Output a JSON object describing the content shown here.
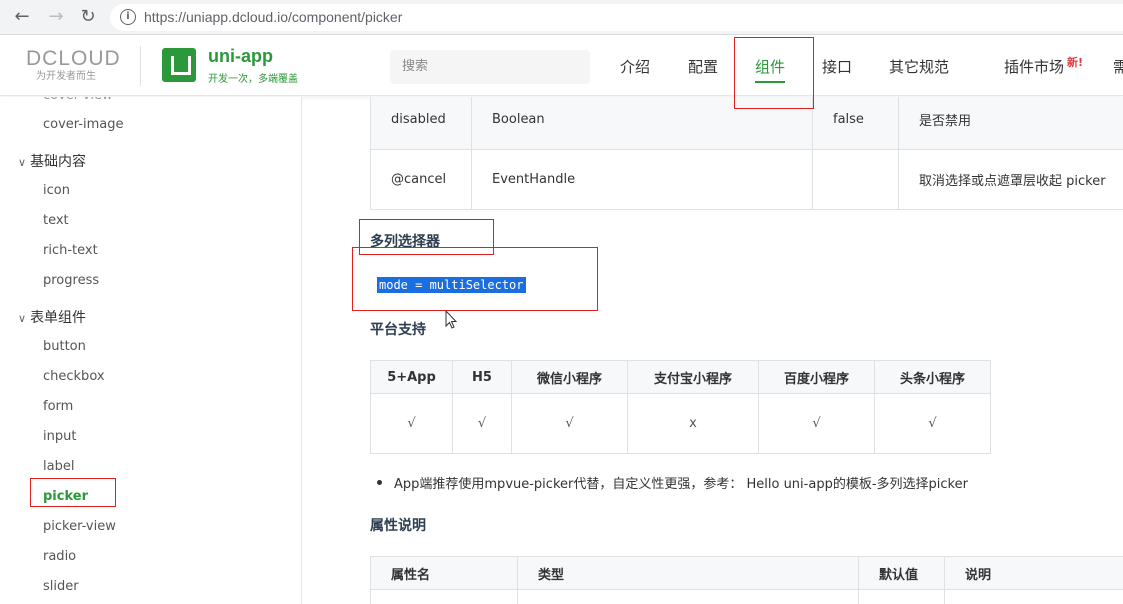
{
  "browser": {
    "url": "https://uniapp.dcloud.io/component/picker",
    "back": "←",
    "forward": "→",
    "reload": "↻",
    "info": "i"
  },
  "header": {
    "dcloud_name": "DCLOUD",
    "dcloud_slogan": "为开发者而生",
    "app_title": "uni-app",
    "app_slogan": "开发一次，多端覆盖",
    "search_placeholder": "搜索",
    "menu": [
      {
        "label": "介绍"
      },
      {
        "label": "配置"
      },
      {
        "label": "组件"
      },
      {
        "label": "接口"
      },
      {
        "label": "其它规范"
      },
      {
        "label": "插件市场",
        "badge": "新!"
      },
      {
        "label": "需"
      }
    ],
    "accent": "#2b9939"
  },
  "sidebar": {
    "items": [
      {
        "label": "cover-view"
      },
      {
        "label": "cover-image"
      },
      {
        "label": "基础内容"
      },
      {
        "label": "icon"
      },
      {
        "label": "text"
      },
      {
        "label": "rich-text"
      },
      {
        "label": "progress"
      },
      {
        "label": "表单组件"
      },
      {
        "label": "button"
      },
      {
        "label": "checkbox"
      },
      {
        "label": "form"
      },
      {
        "label": "input"
      },
      {
        "label": "label"
      },
      {
        "label": "picker"
      },
      {
        "label": "picker-view"
      },
      {
        "label": "radio"
      },
      {
        "label": "slider"
      }
    ]
  },
  "props_table": {
    "rows": [
      [
        "disabled",
        "Boolean",
        "false",
        "是否禁用"
      ],
      [
        "@cancel",
        "EventHandle",
        "",
        "取消选择或点遮罩层收起 picker"
      ]
    ]
  },
  "section": {
    "title": "多列选择器",
    "code": "mode = multiSelector",
    "platform_title": "平台支持",
    "platform_headers": [
      "5+App",
      "H5",
      "微信小程序",
      "支付宝小程序",
      "百度小程序",
      "头条小程序"
    ],
    "platform_values": [
      "√",
      "√",
      "√",
      "x",
      "√",
      "√"
    ],
    "bullet": "App端推荐使用mpvue-picker代替，自定义性更强，参考： Hello uni-app的模板-多列选择picker",
    "attr_title": "属性说明",
    "attr_headers": [
      "属性名",
      "类型",
      "默认值",
      "说明"
    ]
  }
}
